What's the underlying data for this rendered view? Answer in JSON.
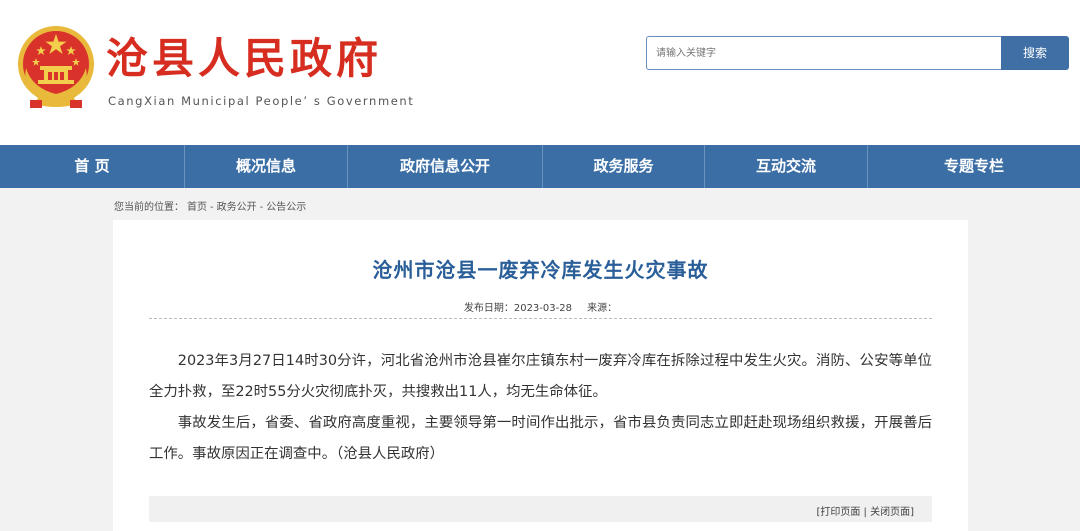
{
  "header": {
    "title": "沧县人民政府",
    "subtitle": "CangXian Municipal People’ s Government",
    "search_placeholder": "请输入关键字",
    "search_button": "搜索"
  },
  "nav": {
    "items": [
      {
        "label": "首 页"
      },
      {
        "label": "概况信息"
      },
      {
        "label": "政府信息公开"
      },
      {
        "label": "政务服务"
      },
      {
        "label": "互动交流"
      },
      {
        "label": "专题专栏"
      }
    ]
  },
  "breadcrumb": {
    "prefix": "您当前的位置：",
    "home": "首页",
    "sep": "-",
    "level1": "政务公开",
    "level2": "公告公示"
  },
  "article": {
    "title": "沧州市沧县一废弃冷库发生火灾事故",
    "date_label": "发布日期：2023-03-28",
    "source_label": "来源：",
    "paragraphs": [
      "2023年3月27日14时30分许，河北省沧州市沧县崔尔庄镇东村一废弃冷库在拆除过程中发生火灾。消防、公安等单位全力扑救，至22时55分火灾彻底扑灭，共搜救出11人，均无生命体征。",
      "事故发生后，省委、省政府高度重视，主要领导第一时间作出批示，省市县负责同志立即赶赴现场组织救援，开展善后工作。事故原因正在调查中。（沧县人民政府）"
    ]
  },
  "footer": {
    "print": "[打印页面",
    "divider": " | ",
    "close": "关闭页面]"
  },
  "colors": {
    "brand_red": "#d62d20",
    "nav_blue": "#3a6ea5",
    "title_blue": "#2a5e99"
  },
  "icons": {
    "emblem": "national-emblem-icon"
  }
}
